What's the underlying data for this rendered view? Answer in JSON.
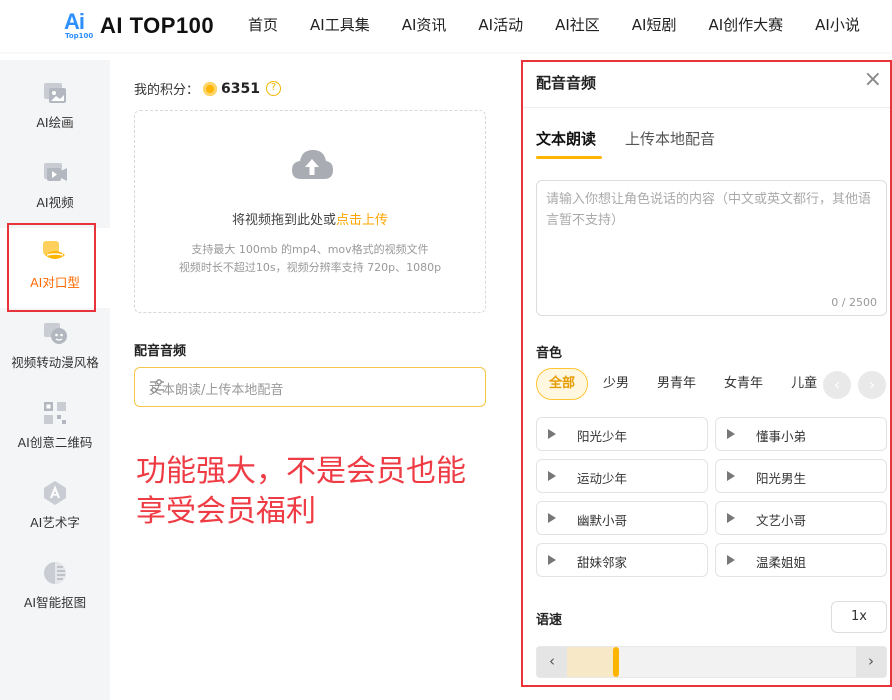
{
  "brand": {
    "logo_mark": "Ai",
    "logo_sub": "Top100",
    "name": "AI TOP100"
  },
  "nav": [
    "首页",
    "AI工具集",
    "AI资讯",
    "AI活动",
    "AI社区",
    "AI短剧",
    "AI创作大赛",
    "AI小说"
  ],
  "sidebar": {
    "items": [
      {
        "label": "AI绘画",
        "icon": "image-icon"
      },
      {
        "label": "AI视频",
        "icon": "video-icon"
      },
      {
        "label": "AI对口型",
        "icon": "lips-icon",
        "active": true
      },
      {
        "label": "视频转动漫风格",
        "icon": "anime-style-icon"
      },
      {
        "label": "AI创意二维码",
        "icon": "qrcode-icon"
      },
      {
        "label": "AI艺术字",
        "icon": "art-text-icon"
      },
      {
        "label": "AI智能抠图",
        "icon": "cutout-icon"
      }
    ]
  },
  "points": {
    "label": "我的积分：",
    "value": "6351",
    "help": "?"
  },
  "upload": {
    "text": "将视频拖到此处或",
    "link": "点击上传",
    "hint1": "支持最大 100mb 的mp4、mov格式的视频文件",
    "hint2": "视频时长不超过10s，视频分辨率支持 720p、1080p"
  },
  "audio": {
    "title": "配音音频",
    "placeholder": "文本朗读/上传本地配音"
  },
  "promo": {
    "line1": "功能强大，不是会员也能",
    "line2": "享受会员福利"
  },
  "panel": {
    "title": "配音音频",
    "close": "×",
    "tabs": [
      "文本朗读",
      "上传本地配音"
    ],
    "textarea_placeholder": "请输入你想让角色说话的内容（中文或英文都行，其他语言暂不支持）",
    "counter": "0 / 2500",
    "voice_label": "音色",
    "voice_filters": [
      "全部",
      "少男",
      "男青年",
      "女青年",
      "儿童"
    ],
    "voices": [
      "阳光少年",
      "懂事小弟",
      "运动少年",
      "阳光男生",
      "幽默小哥",
      "文艺小哥",
      "甜妹邻家",
      "温柔姐姐"
    ],
    "speed_label": "语速",
    "speed_value": "1x",
    "slider_level": 0.16
  },
  "colors": {
    "accent": "#ffb400",
    "highlight_red": "#e8333b",
    "active_text": "#ff6a00"
  }
}
